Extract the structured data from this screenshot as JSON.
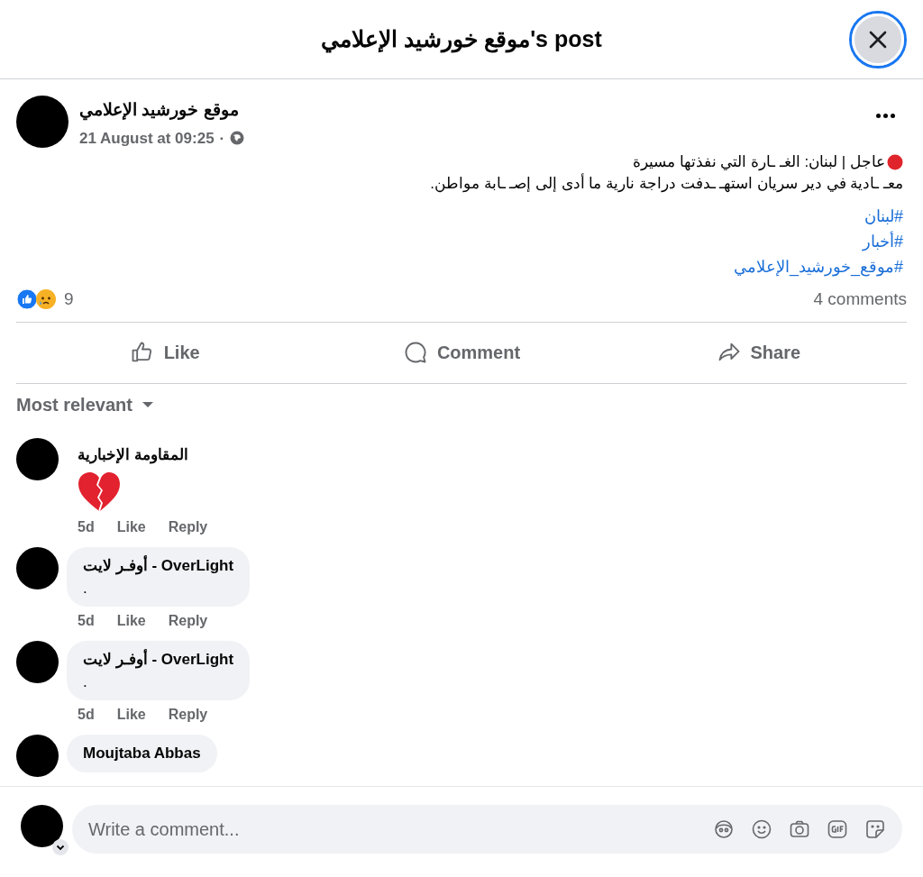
{
  "dialog": {
    "title": "موقع خورشيد الإعلامي's post"
  },
  "post": {
    "author": "موقع خورشيد الإعلامي",
    "time": "21 August at 09:25",
    "separator": "·",
    "lines": [
      "عاجل | لبنان: الغـ ـارة التي نفذتها مسيرة",
      "معـ ـادية في دير سريان استهـ ـدفت دراجة نارية ما أدى إلى إصـ ـابة مواطن."
    ],
    "hashtags": [
      "#لبنان",
      "#أخبار",
      "#موقع_خورشيد_الإعلامي"
    ],
    "reaction_count": "9",
    "comment_count": "4 comments"
  },
  "actions": {
    "like": "Like",
    "comment": "Comment",
    "share": "Share"
  },
  "sort": {
    "label": "Most relevant"
  },
  "comments": [
    {
      "kind": "emoji",
      "name": "المقاومة الإخبارية",
      "meta": {
        "time": "5d",
        "like": "Like",
        "reply": "Reply"
      }
    },
    {
      "kind": "bubble",
      "name": "أوفـر لايت - OverLight",
      "text": ".",
      "meta": {
        "time": "5d",
        "like": "Like",
        "reply": "Reply"
      }
    },
    {
      "kind": "bubble",
      "name": "أوفـر لايت - OverLight",
      "text": ".",
      "meta": {
        "time": "5d",
        "like": "Like",
        "reply": "Reply"
      }
    },
    {
      "kind": "bubble",
      "name": "Moujtaba Abbas"
    }
  ],
  "composer": {
    "placeholder": "Write a comment..."
  }
}
